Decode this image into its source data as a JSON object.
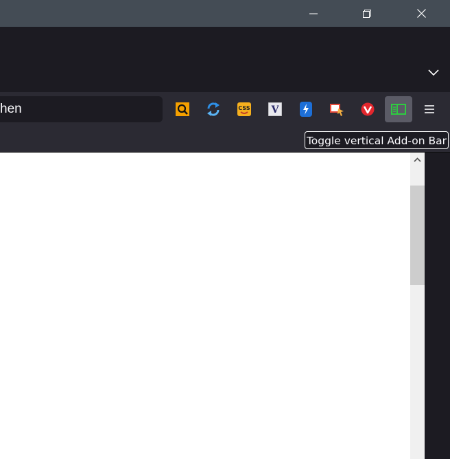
{
  "window": {
    "minimize_icon": "minimize-icon",
    "restore_icon": "restore-icon",
    "close_icon": "close-icon"
  },
  "tabstrip": {
    "list_all_tabs_icon": "chevron-down-icon"
  },
  "urlbar": {
    "visible_text": "hen"
  },
  "extensions": [
    {
      "name": "search-magnifier-addon",
      "icon": "magnifier-icon"
    },
    {
      "name": "sync-addon",
      "icon": "refresh-icon"
    },
    {
      "name": "css-addon",
      "icon": "css-icon",
      "label": "CSS"
    },
    {
      "name": "v-addon",
      "icon": "v-icon",
      "label": "V"
    },
    {
      "name": "bolt-addon",
      "icon": "bolt-icon"
    },
    {
      "name": "screenshot-addon",
      "icon": "screenshot-icon"
    },
    {
      "name": "vivaldi-addon",
      "icon": "v-circle-icon",
      "label": "V"
    },
    {
      "name": "vertical-addon-bar-toggle",
      "icon": "sidebar-toggle-icon",
      "active": true
    }
  ],
  "menu": {
    "icon": "hamburger-icon"
  },
  "tooltip": {
    "text": "Toggle vertical Add-on Bar"
  },
  "colors": {
    "titlebar": "#444c55",
    "tabstrip": "#1c1b22",
    "toolbar": "#2b2a33",
    "active_button": "#5b5b66",
    "content": "#ffffff",
    "scrollbar_thumb": "#cdcdcd"
  }
}
